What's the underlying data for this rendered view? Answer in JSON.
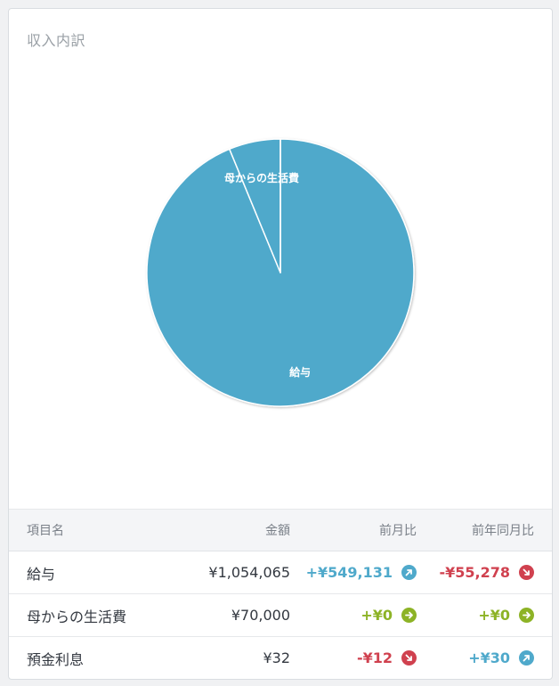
{
  "card": {
    "title": "収入内訳"
  },
  "chart_data": {
    "type": "pie",
    "title": "収入内訳",
    "slices": [
      {
        "label": "給与",
        "value": 1054065,
        "show_label": true
      },
      {
        "label": "母からの生活費",
        "value": 70000,
        "show_label": true
      },
      {
        "label": "預金利息",
        "value": 32,
        "show_label": false
      }
    ],
    "slice_color": "#4fa9cb",
    "border_color": "#ffffff",
    "start": "top, clockwise"
  },
  "table": {
    "headers": {
      "name": "項目名",
      "amount": "金額",
      "mom": "前月比",
      "yoy": "前年同月比"
    },
    "rows": [
      {
        "name": "給与",
        "amount": "¥1,054,065",
        "mom": {
          "text": "+¥549,131",
          "trend": "up",
          "icon": "arrow-up-right-icon"
        },
        "yoy": {
          "text": "-¥55,278",
          "trend": "down",
          "icon": "arrow-down-right-icon"
        }
      },
      {
        "name": "母からの生活費",
        "amount": "¥70,000",
        "mom": {
          "text": "+¥0",
          "trend": "flat",
          "icon": "arrow-right-icon"
        },
        "yoy": {
          "text": "+¥0",
          "trend": "flat",
          "icon": "arrow-right-icon"
        }
      },
      {
        "name": "預金利息",
        "amount": "¥32",
        "mom": {
          "text": "-¥12",
          "trend": "down",
          "icon": "arrow-down-right-icon"
        },
        "yoy": {
          "text": "+¥30",
          "trend": "up",
          "icon": "arrow-up-right-icon"
        }
      }
    ]
  },
  "colors": {
    "up": "#4fa9cb",
    "down": "#d0414f",
    "flat": "#8db326"
  }
}
